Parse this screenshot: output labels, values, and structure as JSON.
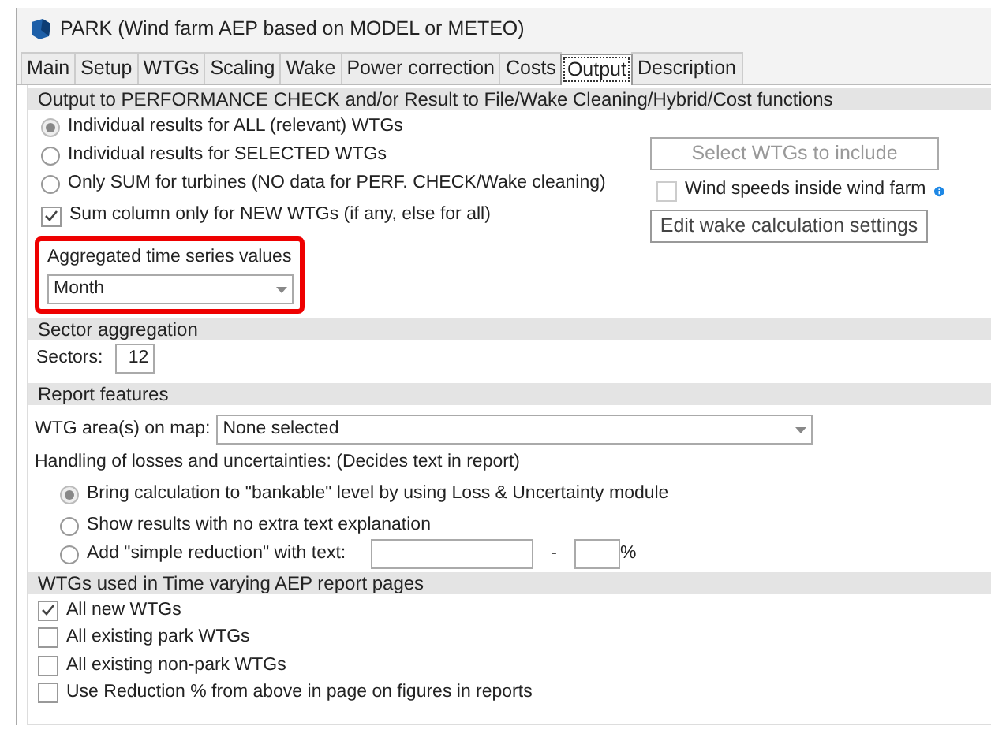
{
  "window": {
    "title": "PARK (Wind farm AEP based on MODEL or METEO)"
  },
  "tabs": [
    {
      "label": "Main",
      "selected": false
    },
    {
      "label": "Setup",
      "selected": false
    },
    {
      "label": "WTGs",
      "selected": false
    },
    {
      "label": "Scaling",
      "selected": false
    },
    {
      "label": "Wake",
      "selected": false
    },
    {
      "label": "Power correction",
      "selected": false
    },
    {
      "label": "Costs",
      "selected": false
    },
    {
      "label": "Output",
      "selected": true
    },
    {
      "label": "Description",
      "selected": false
    }
  ],
  "output_section": {
    "title": "Output to PERFORMANCE CHECK and/or Result to File/Wake Cleaning/Hybrid/Cost functions",
    "options": [
      {
        "kind": "radio",
        "label": "Individual results for ALL (relevant) WTGs",
        "selected": true,
        "disabled": true
      },
      {
        "kind": "radio",
        "label": "Individual results for SELECTED WTGs",
        "selected": false,
        "disabled": false
      },
      {
        "kind": "radio",
        "label": "Only SUM for turbines (NO data for PERF. CHECK/Wake cleaning)",
        "selected": false,
        "disabled": false
      },
      {
        "kind": "checkbox",
        "label": "Sum column only for NEW WTGs (if any, else for all)",
        "checked": true,
        "disabled": false
      }
    ],
    "select_button": {
      "label": "Select WTGs to include",
      "disabled": true
    },
    "wind_speeds": {
      "label": "Wind speeds inside wind farm",
      "checked": false
    },
    "edit_button": {
      "label": "Edit wake calculation settings",
      "disabled": false
    },
    "aggregated": {
      "label": "Aggregated time series values",
      "value": "Month",
      "highlighted": true
    }
  },
  "sector_section": {
    "title": "Sector aggregation",
    "label": "Sectors:",
    "value": "12"
  },
  "report_section": {
    "title": "Report features",
    "area_label": "WTG area(s) on map:",
    "area_value": "None selected",
    "handling_label": "Handling of losses and uncertainties: (Decides text in report)",
    "handling_options": [
      {
        "label": "Bring calculation to \"bankable\" level by using Loss & Uncertainty module",
        "selected": true,
        "disabled": true
      },
      {
        "label": "Show results with no extra text explanation",
        "selected": false,
        "disabled": false
      },
      {
        "label": "Add \"simple reduction\" with text:",
        "selected": false,
        "disabled": false
      }
    ],
    "dash": "-",
    "percent": "%"
  },
  "wtg_section": {
    "title": "WTGs used in Time varying AEP report pages",
    "options": [
      {
        "label": "All new WTGs",
        "checked": true
      },
      {
        "label": "All existing park WTGs",
        "checked": false
      },
      {
        "label": "All existing non-park WTGs",
        "checked": false
      },
      {
        "label": "Use Reduction % from above in page on figures in reports",
        "checked": false
      }
    ]
  }
}
